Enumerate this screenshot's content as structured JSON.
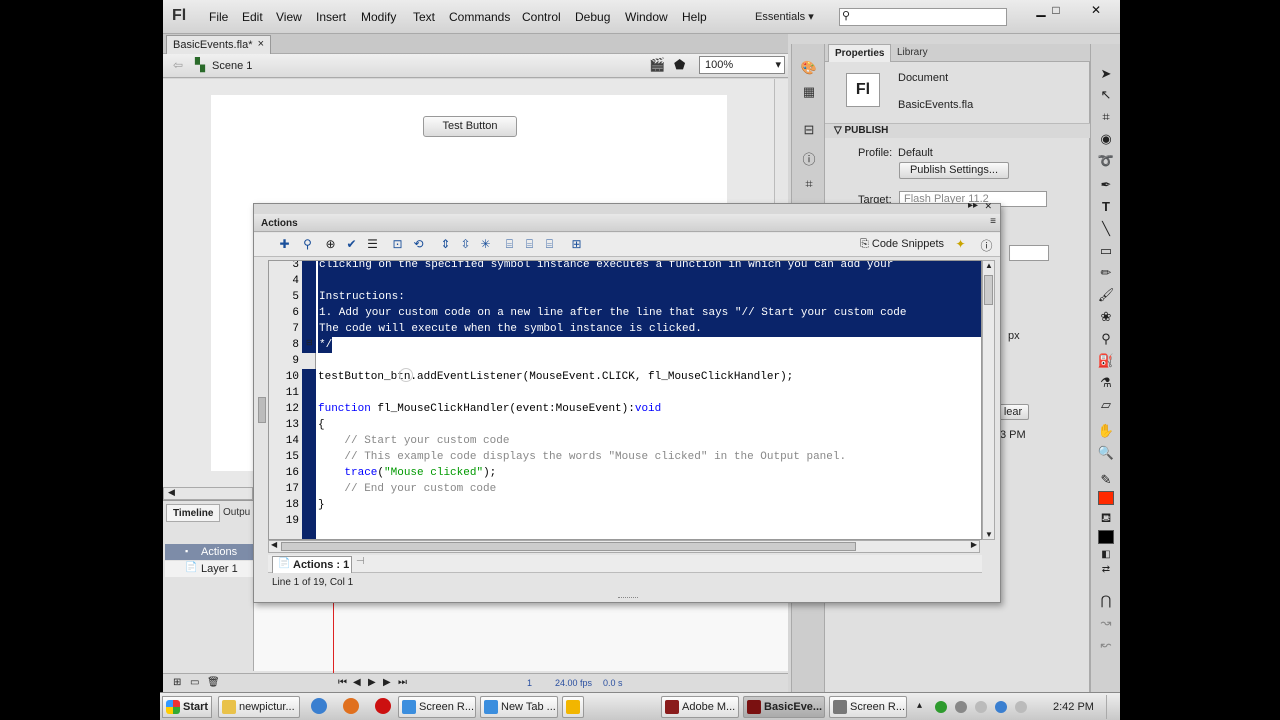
{
  "menubar": {
    "logo": "Fl",
    "items": [
      "File",
      "Edit",
      "View",
      "Insert",
      "Modify",
      "Text",
      "Commands",
      "Control",
      "Debug",
      "Window",
      "Help"
    ],
    "workspace": "Essentials"
  },
  "document": {
    "tab": "BasicEvents.fla*",
    "scene": "Scene 1",
    "zoom": "100%",
    "stage_button": "Test Button"
  },
  "timeline": {
    "tabs": [
      "Timeline",
      "Outpu"
    ],
    "layers": [
      "Actions",
      "Layer 1"
    ],
    "frame": "1",
    "fps": "24.00 fps",
    "time": "0.0 s"
  },
  "properties": {
    "tabs": [
      "Properties",
      "Library"
    ],
    "type": "Document",
    "filename": "BasicEvents.fla",
    "section": "PUBLISH",
    "profile_label": "Profile:",
    "profile_value": "Default",
    "publish_settings": "Publish Settings...",
    "target_label": "Target:",
    "target_value": "Flash Player 11.2",
    "unit": "px",
    "clear": "lear",
    "time_partial": "3 PM"
  },
  "actions_panel": {
    "title": "Actions",
    "code_snippets": "Code Snippets",
    "tab_label": "Actions : 1",
    "status": "Line 1 of 19, Col 1",
    "lines": [
      {
        "n": "3",
        "text": "clicking on the specified symbol instance executes a function in which you can add your",
        "cls": "sel"
      },
      {
        "n": "4",
        "text": "",
        "cls": "sel"
      },
      {
        "n": "5",
        "text": "Instructions:",
        "cls": "sel"
      },
      {
        "n": "6",
        "text": "1. Add your custom code on a new line after the line that says \"// Start your custom code",
        "cls": "sel"
      },
      {
        "n": "7",
        "text": "The code will execute when the symbol instance is clicked.",
        "cls": "sel"
      },
      {
        "n": "8",
        "text": "*/",
        "cls": "selshort"
      },
      {
        "n": "9",
        "text": "",
        "cls": ""
      },
      {
        "n": "10",
        "text": "testButton_btn.addEventListener(MouseEvent.CLICK, fl_MouseClickHandler);",
        "cls": ""
      },
      {
        "n": "11",
        "text": "",
        "cls": ""
      },
      {
        "n": "12",
        "text": "function fl_MouseClickHandler(event:MouseEvent):void",
        "cls": "fn"
      },
      {
        "n": "13",
        "text": "{",
        "cls": ""
      },
      {
        "n": "14",
        "text": "    // Start your custom code",
        "cls": "cm"
      },
      {
        "n": "15",
        "text": "    // This example code displays the words \"Mouse clicked\" in the Output panel.",
        "cls": "cm"
      },
      {
        "n": "16",
        "text": "    trace(\"Mouse clicked\");",
        "cls": "trace"
      },
      {
        "n": "17",
        "text": "    // End your custom code",
        "cls": "cm"
      },
      {
        "n": "18",
        "text": "}",
        "cls": ""
      },
      {
        "n": "19",
        "text": "",
        "cls": ""
      }
    ]
  },
  "taskbar": {
    "start": "Start",
    "items": [
      {
        "label": "newpictur...",
        "color": "#e9c24a"
      },
      {
        "label": "Screen R...",
        "color": "#3b8ede"
      },
      {
        "label": "New Tab ...",
        "color": "#3b8ede"
      },
      {
        "label": "Adobe M...",
        "color": "#8a1c1c"
      },
      {
        "label": "BasicEve...",
        "color": "#7a1010"
      },
      {
        "label": "Screen R...",
        "color": "#777777"
      }
    ],
    "clock": "2:42 PM"
  }
}
